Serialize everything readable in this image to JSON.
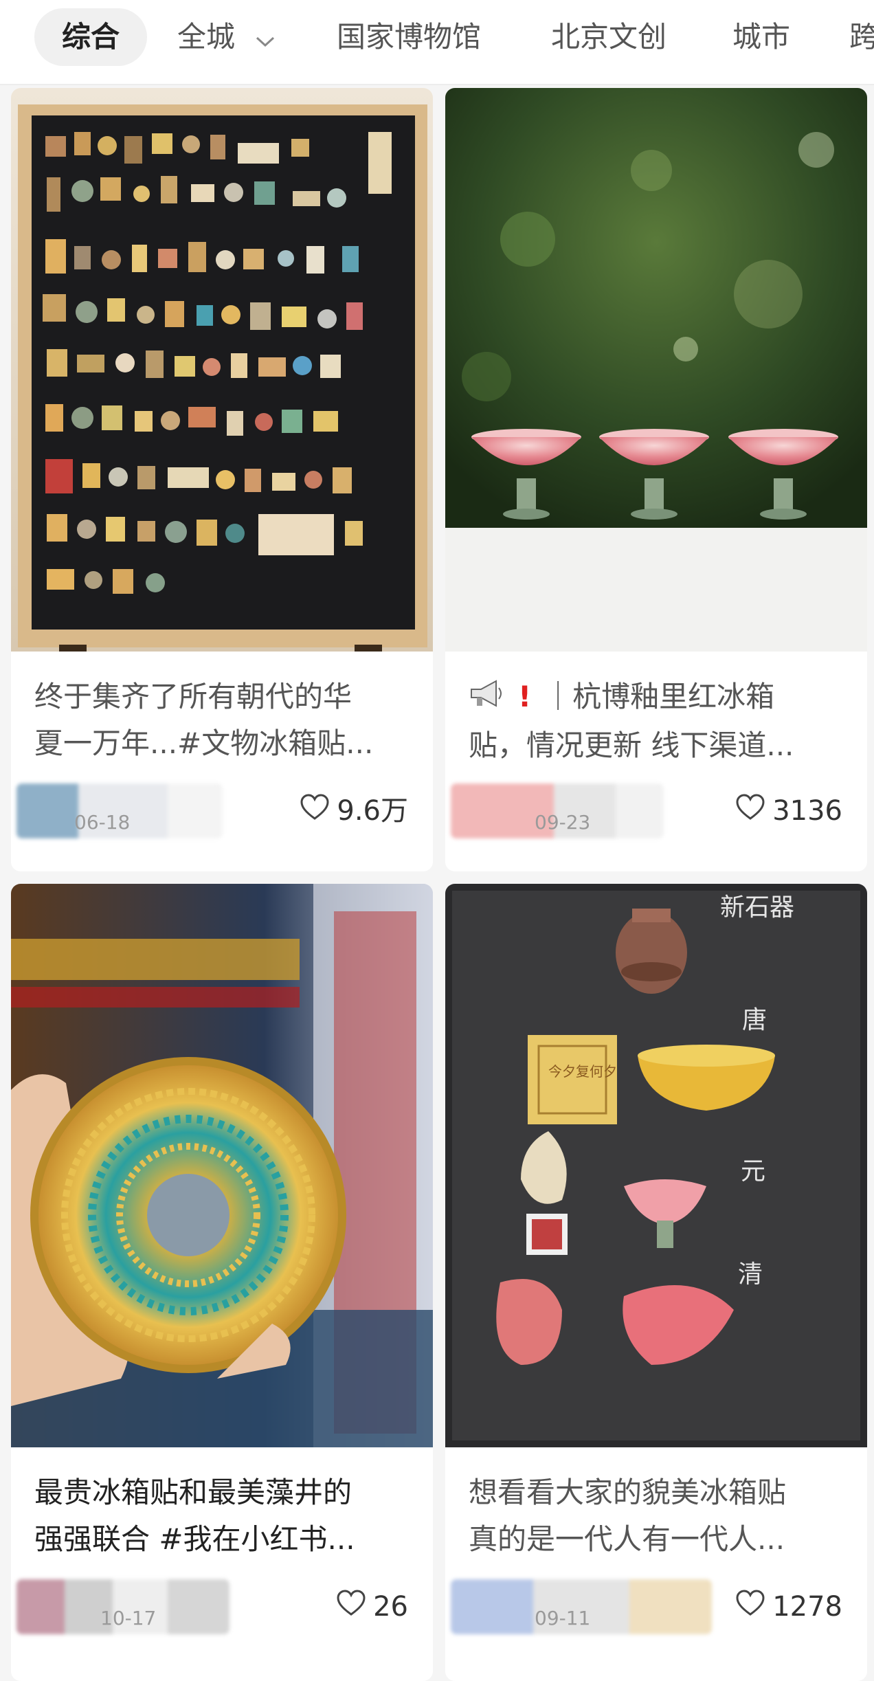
{
  "tabs": [
    {
      "label": "综合",
      "active": true
    },
    {
      "label": "全城",
      "has_dropdown": true
    },
    {
      "label": "国家博物馆"
    },
    {
      "label": "北京文创"
    },
    {
      "label": "城市"
    },
    {
      "label": "跨"
    }
  ],
  "cards": [
    {
      "title_lines": [
        "终于集齐了所有朝代的华",
        "夏一万年...#文物冰箱贴..."
      ],
      "date": "06-18",
      "likes": "9.6万",
      "image": "framed-black-board-with-many-museum-fridge-magnets"
    },
    {
      "title_prefix_icons": [
        "megaphone-icon",
        "exclamation-icon"
      ],
      "title_lines": [
        "｜杭博釉里红冰箱",
        "贴，情况更新 线下渠道..."
      ],
      "date": "09-23",
      "likes": "3136",
      "image": "three-pink-lotus-stem-cups-on-white-surface"
    },
    {
      "title_lines": [
        "最贵冰箱贴和最美藻井的",
        "强强联合 #我在小红书..."
      ],
      "date": "10-17",
      "likes": "26",
      "image": "hand-holding-golden-caisson-ceiling-magnet"
    },
    {
      "title_lines": [
        "想看看大家的貌美冰箱贴",
        "真的是一代人有一代人..."
      ],
      "date": "09-11",
      "likes": "1278",
      "image": "dark-board-with-dynasty-fridge-magnets",
      "board_labels": [
        "新石器",
        "唐",
        "元",
        "清",
        "今夕复何夕"
      ]
    }
  ],
  "colors": {
    "background": "#f5f5f5",
    "card": "#ffffff",
    "active_tab_bg": "#f0f0f0",
    "text_primary": "#222222",
    "text_secondary": "#555555",
    "date_text": "#9a9a9a",
    "alert_red": "#e02020"
  }
}
